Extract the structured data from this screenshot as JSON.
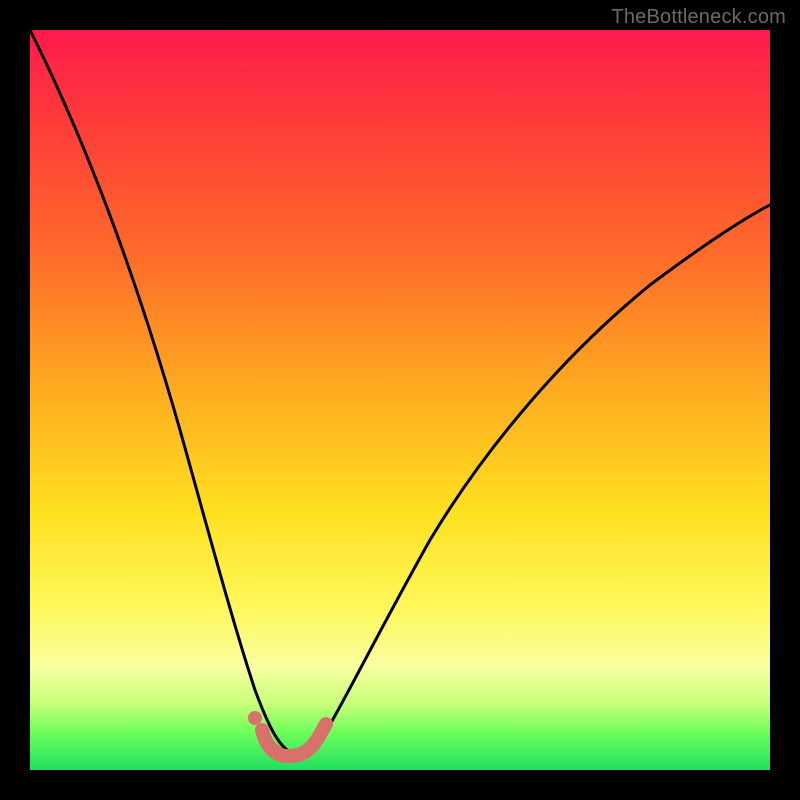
{
  "watermark": "TheBottleneck.com",
  "chart_data": {
    "type": "line",
    "title": "",
    "xlabel": "",
    "ylabel": "",
    "xlim": [
      0,
      100
    ],
    "ylim": [
      0,
      100
    ],
    "series": [
      {
        "name": "bottleneck-curve",
        "x": [
          0,
          5,
          10,
          15,
          20,
          23,
          26,
          29,
          31,
          33,
          35,
          37,
          39,
          42,
          46,
          52,
          60,
          70,
          82,
          92,
          100
        ],
        "values": [
          100,
          90,
          77,
          62,
          44,
          31,
          19,
          10,
          5,
          3,
          2,
          2,
          3,
          6,
          12,
          21,
          33,
          46,
          58,
          66,
          72
        ]
      }
    ],
    "annotations": [
      {
        "name": "trough-marker-start",
        "x": 30.5,
        "y": 4.0
      },
      {
        "name": "trough-marker-end",
        "x": 39.0,
        "y": 4.0
      }
    ],
    "gradient_stops": [
      {
        "pos": 0.0,
        "color": "#ff1a4d"
      },
      {
        "pos": 0.5,
        "color": "#ffb020"
      },
      {
        "pos": 0.8,
        "color": "#fff85a"
      },
      {
        "pos": 1.0,
        "color": "#20e060"
      }
    ]
  }
}
